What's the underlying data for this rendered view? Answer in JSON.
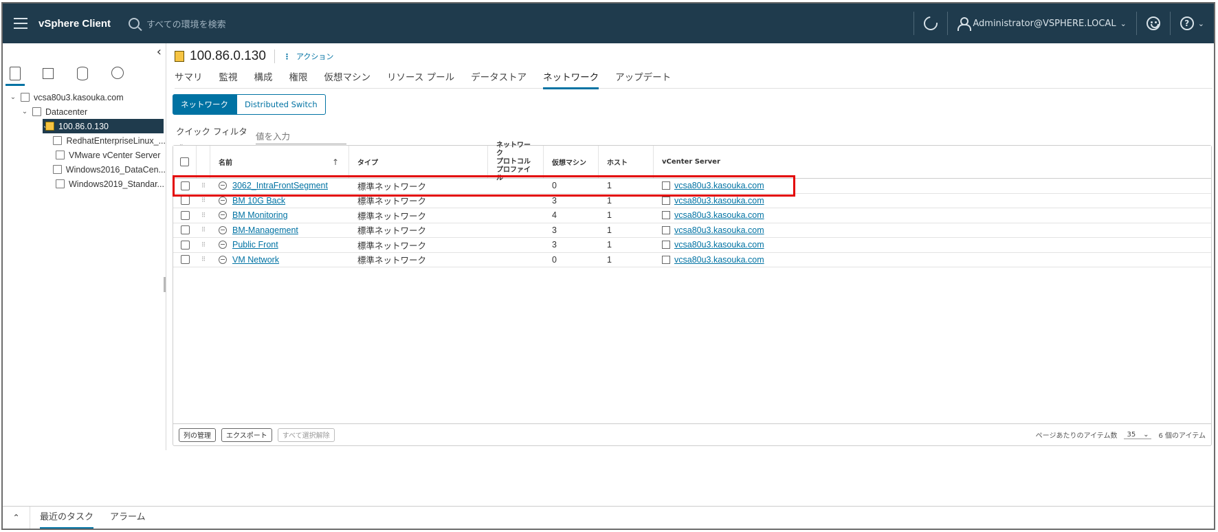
{
  "header": {
    "app_title": "vSphere Client",
    "search_placeholder": "すべての環境を検索",
    "user": "Administrator@VSPHERE.LOCAL"
  },
  "colors": {
    "header_bg": "#1f3b4d",
    "accent": "#0072a3",
    "highlight": "#e30000",
    "selected_bg": "#1f3b4d"
  },
  "nav": {
    "tree": [
      {
        "label": "vcsa80u3.kasouka.com",
        "icon": "vcenter-icon",
        "level": 0,
        "expanded": true
      },
      {
        "label": "Datacenter",
        "icon": "datacenter-icon",
        "level": 1,
        "expanded": true
      },
      {
        "label": "100.86.0.130",
        "icon": "host-icon",
        "level": 2,
        "expanded": true,
        "selected": true
      },
      {
        "label": "RedhatEnterpriseLinux_...",
        "icon": "vm-icon",
        "level": 3
      },
      {
        "label": "VMware vCenter Server",
        "icon": "vm-icon",
        "level": 3
      },
      {
        "label": "Windows2016_DataCen...",
        "icon": "vm-icon",
        "level": 3
      },
      {
        "label": "Windows2019_Standar...",
        "icon": "vm-icon",
        "level": 3
      }
    ]
  },
  "main": {
    "title": "100.86.0.130",
    "actions_label": "アクション",
    "tabs": [
      "サマリ",
      "監視",
      "構成",
      "権限",
      "仮想マシン",
      "リソース プール",
      "データストア",
      "ネットワーク",
      "アップデート"
    ],
    "active_tab": "ネットワーク",
    "segment": {
      "active": "ネットワーク",
      "other": "Distributed Switch"
    },
    "filter": {
      "label": "クイック フィルタ",
      "placeholder": "値を入力"
    },
    "columns": {
      "name": "名前",
      "type": "タイプ",
      "proto": [
        "ネットワーク",
        "プロトコル",
        "プロファイル"
      ],
      "vms": "仮想マシン",
      "hosts": "ホスト",
      "vcenter": "vCenter Server"
    },
    "rows": [
      {
        "name": "3062_IntraFrontSegment",
        "type": "標準ネットワーク",
        "proto": "",
        "vms": "0",
        "hosts": "1",
        "vcenter": "vcsa80u3.kasouka.com",
        "highlighted": true
      },
      {
        "name": "BM 10G Back",
        "type": "標準ネットワーク",
        "proto": "",
        "vms": "3",
        "hosts": "1",
        "vcenter": "vcsa80u3.kasouka.com"
      },
      {
        "name": "BM Monitoring",
        "type": "標準ネットワーク",
        "proto": "",
        "vms": "4",
        "hosts": "1",
        "vcenter": "vcsa80u3.kasouka.com"
      },
      {
        "name": "BM-Management",
        "type": "標準ネットワーク",
        "proto": "",
        "vms": "3",
        "hosts": "1",
        "vcenter": "vcsa80u3.kasouka.com"
      },
      {
        "name": "Public Front",
        "type": "標準ネットワーク",
        "proto": "",
        "vms": "3",
        "hosts": "1",
        "vcenter": "vcsa80u3.kasouka.com"
      },
      {
        "name": "VM Network",
        "type": "標準ネットワーク",
        "proto": "",
        "vms": "0",
        "hosts": "1",
        "vcenter": "vcsa80u3.kasouka.com"
      }
    ],
    "footer": {
      "manage_columns": "列の管理",
      "export": "エクスポート",
      "deselect_all": "すべて選択解除",
      "per_page_label": "ページあたりのアイテム数",
      "per_page_value": "35",
      "item_count": "6 個のアイテム"
    }
  },
  "bottom": {
    "recent_tasks": "最近のタスク",
    "alarms": "アラーム"
  }
}
